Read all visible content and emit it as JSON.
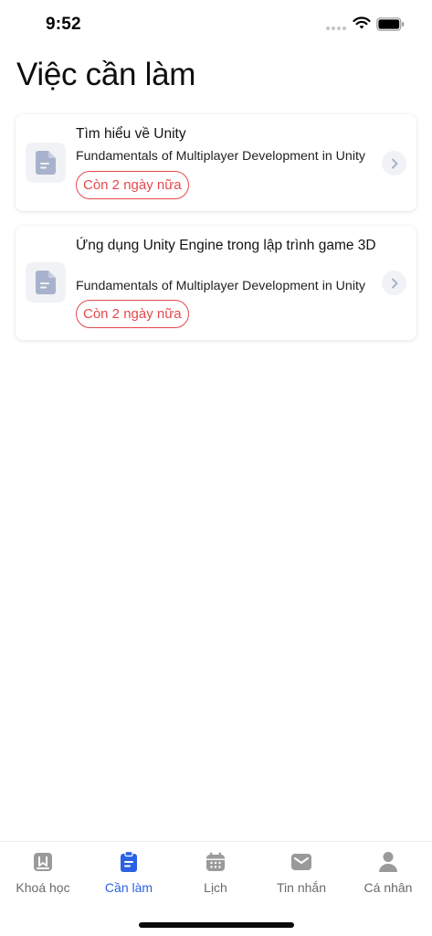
{
  "status_bar": {
    "time": "9:52"
  },
  "page": {
    "title": "Việc cần làm"
  },
  "tasks": [
    {
      "title": "Tìm hiểu về Unity",
      "course": "Fundamentals of Multiplayer Development in Unity",
      "deadline": "Còn 2 ngày nữa",
      "icon": "document-icon"
    },
    {
      "title": "Ứng dụng Unity Engine trong lập trình game 3D",
      "course": "Fundamentals of Multiplayer Development in Unity",
      "deadline": "Còn 2 ngày nữa",
      "icon": "document-icon"
    }
  ],
  "tab_bar": {
    "active_index": 1,
    "tabs": [
      {
        "label": "Khoá học",
        "icon": "book-icon"
      },
      {
        "label": "Cần làm",
        "icon": "clipboard-icon"
      },
      {
        "label": "Lịch",
        "icon": "calendar-icon"
      },
      {
        "label": "Tin nhắn",
        "icon": "mail-icon"
      },
      {
        "label": "Cá nhân",
        "icon": "person-icon"
      }
    ]
  },
  "colors": {
    "accent": "#2a62e3",
    "deadline": "#e5484d",
    "icon_muted": "#a8b2cc",
    "tab_inactive": "#9a9a9a"
  }
}
